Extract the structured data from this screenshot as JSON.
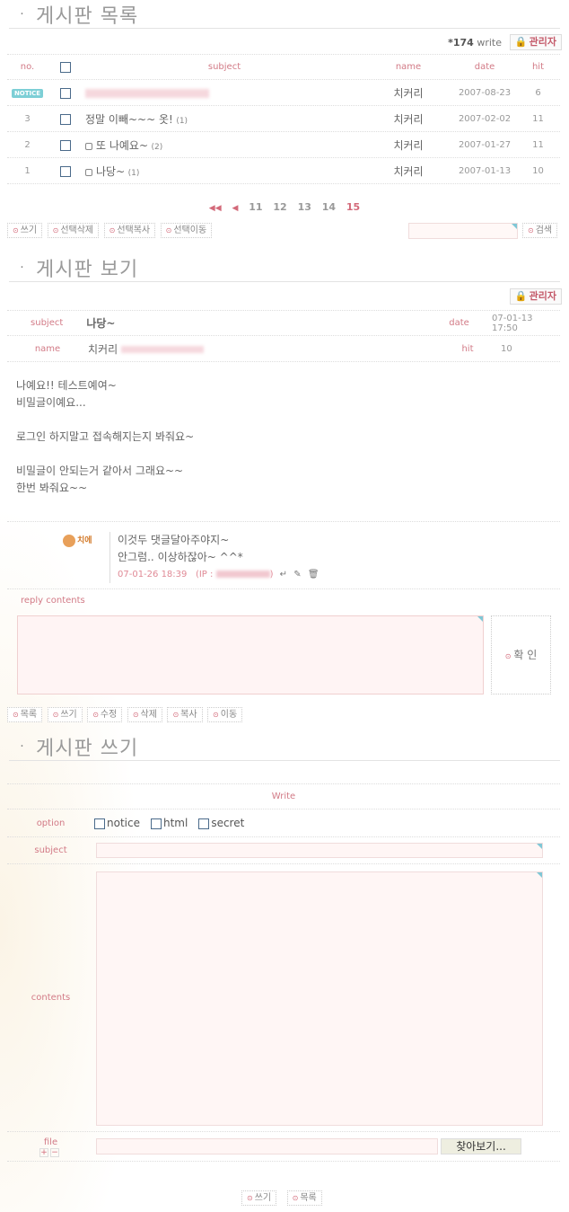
{
  "list": {
    "title": "게시판 목록",
    "count_value": "174",
    "count_suffix": "write",
    "admin_label": "관리자",
    "columns": {
      "no": "no.",
      "subject": "subject",
      "name": "name",
      "date": "date",
      "hit": "hit"
    },
    "rows": [
      {
        "no": "NOTICE",
        "subject": "",
        "comments": "",
        "name": "치커리",
        "date": "2007-08-23",
        "hit": "6"
      },
      {
        "no": "3",
        "subject": "정말 이빼~~~ 옷!",
        "comments": "(1)",
        "name": "치커리",
        "date": "2007-02-02",
        "hit": "11"
      },
      {
        "no": "2",
        "subject": "또 나예요~",
        "comments": "(2)",
        "name": "치커리",
        "date": "2007-01-27",
        "hit": "11"
      },
      {
        "no": "1",
        "subject": "나당~",
        "comments": "(1)",
        "name": "치커리",
        "date": "2007-01-13",
        "hit": "10"
      }
    ],
    "pages": [
      "11",
      "12",
      "13",
      "14",
      "15"
    ],
    "current_page": "15",
    "buttons": [
      "쓰기",
      "선택삭제",
      "선택복사",
      "선택이동"
    ],
    "search_label": "검색"
  },
  "view": {
    "title": "게시판 보기",
    "admin_label": "관리자",
    "subject_label": "subject",
    "subject_value": "나당~",
    "date_label": "date",
    "date_value": "07-01-13 17:50",
    "name_label": "name",
    "name_value": "치커리",
    "hit_label": "hit",
    "hit_value": "10",
    "body": "나예요!! 테스트예여~\n비밀글이예요...\n\n로그인 하지말고 접속해지는지 봐줘요~\n\n비밀글이 안되는거 같아서 그래요~~\n한번 봐줘요~~",
    "reply": {
      "author": "치에",
      "line1": "이것두 댓글달아주야지~",
      "line2": "안그럼.. 이상하잖아~ ^^*",
      "date": "07-01-26 18:39",
      "ip_label": "(IP :",
      "ip_end": ")"
    },
    "reply_label": "reply contents",
    "ok_label": "확 인",
    "buttons": [
      "목록",
      "쓰기",
      "수정",
      "삭제",
      "복사",
      "이동"
    ]
  },
  "write": {
    "title": "게시판 쓰기",
    "heading": "Write",
    "option_label": "option",
    "options": [
      "notice",
      "html",
      "secret"
    ],
    "subject_label": "subject",
    "contents_label": "contents",
    "file_label": "file",
    "browse_label": "찾아보기...",
    "buttons": [
      "쓰기",
      "목록"
    ]
  },
  "colors": {
    "accent": "#d36a7a",
    "label": "#d27a86",
    "input_bg": "#fff6f5"
  }
}
